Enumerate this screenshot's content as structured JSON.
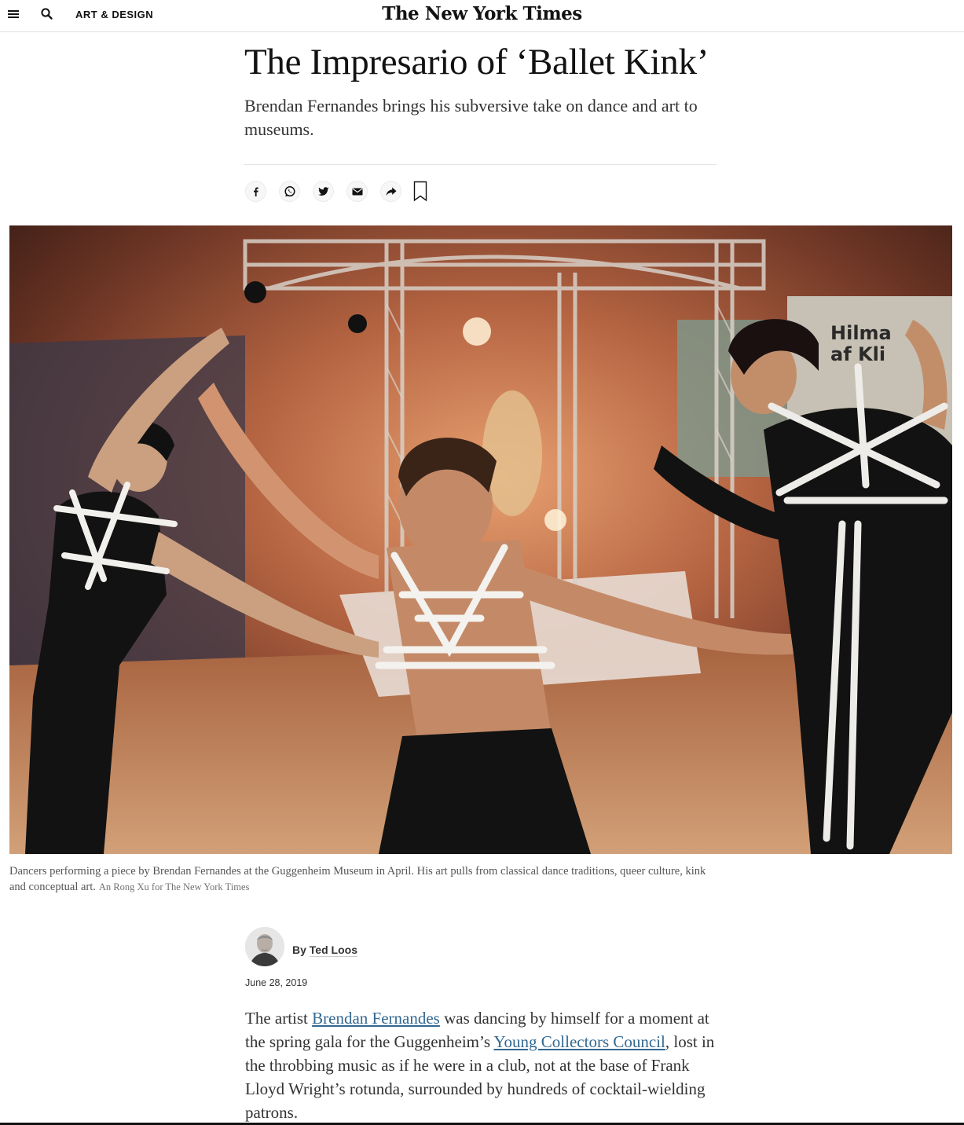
{
  "header": {
    "menu_icon": "hamburger-menu-icon",
    "search_icon": "search-icon",
    "section": "ART & DESIGN",
    "masthead": "The New York Times"
  },
  "article": {
    "headline": "The Impresario of ‘Ballet Kink’",
    "summary": "Brendan Fernandes brings his subversive take on dance and art to museums."
  },
  "share_tools": [
    {
      "icon": "facebook-icon"
    },
    {
      "icon": "whatsapp-icon"
    },
    {
      "icon": "twitter-icon"
    },
    {
      "icon": "email-icon"
    },
    {
      "icon": "share-arrow-icon"
    },
    {
      "icon": "bookmark-icon"
    }
  ],
  "photo": {
    "caption": "Dancers performing a piece by Brendan Fernandes at the Guggenheim Museum in April. His art pulls from classical dance traditions, queer culture, kink and conceptual art.",
    "credit": "An Rong Xu for The New York Times",
    "sign_text_1": "Hilma",
    "sign_text_2": "af Kli"
  },
  "byline": {
    "prefix": "By",
    "author": "Ted Loos",
    "date": "June 28, 2019"
  },
  "body": {
    "p1_a": "The artist ",
    "p1_link1": "Brendan Fernandes",
    "p1_b": " was dancing by himself for a moment at the spring gala for the Guggenheim’s ",
    "p1_link2": "Young Collectors Council",
    "p1_c": ", lost in the throbbing music as if he were in a club, not at the base of Frank Lloyd Wright’s rotunda, surrounded by hundreds of cocktail-wielding patrons."
  },
  "colors": {
    "link": "#326891",
    "text": "#333333",
    "rule": "#e2e2e2"
  }
}
